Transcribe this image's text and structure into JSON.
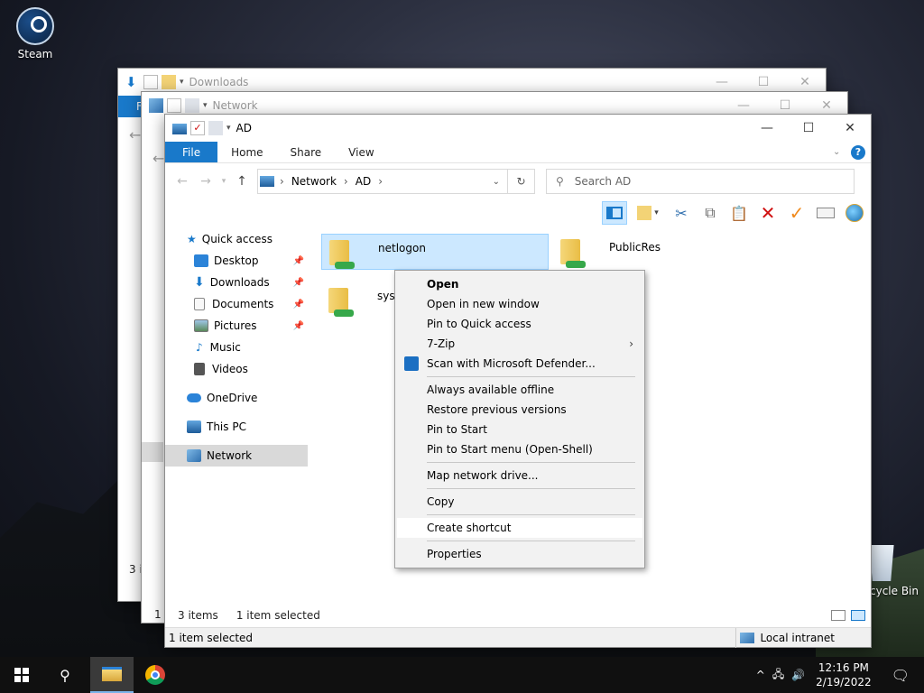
{
  "desktop": {
    "steam_label": "Steam",
    "recycle_label": "cycle Bin"
  },
  "windows": {
    "downloads": {
      "title": "Downloads",
      "ribbon_file_partial": "F",
      "status_items_partial": "3 it"
    },
    "network": {
      "title": "Network",
      "status_selected_partial": "1 it"
    },
    "ad": {
      "title": "AD",
      "tabs": [
        "File",
        "Home",
        "Share",
        "View"
      ],
      "breadcrumb": [
        "Network",
        "AD"
      ],
      "search_placeholder": "Search AD",
      "nav": {
        "quick_access": "Quick access",
        "desktop": "Desktop",
        "downloads": "Downloads",
        "documents": "Documents",
        "pictures": "Pictures",
        "music": "Music",
        "videos": "Videos",
        "onedrive": "OneDrive",
        "thispc": "This PC",
        "network": "Network"
      },
      "files": {
        "netlogon": "netlogon",
        "publicres": "PublicRes",
        "sysvol": "sysvc"
      },
      "status": {
        "count": "3 items",
        "selected": "1 item selected"
      },
      "details": {
        "selected": "1 item selected",
        "zone": "Local intranet"
      }
    }
  },
  "context_menu": {
    "open": "Open",
    "open_new_window": "Open in new window",
    "pin_quick_access": "Pin to Quick access",
    "sevenzip": "7-Zip",
    "defender": "Scan with Microsoft Defender...",
    "always_offline": "Always available offline",
    "restore_versions": "Restore previous versions",
    "pin_start": "Pin to Start",
    "pin_start_openshell": "Pin to Start menu (Open-Shell)",
    "map_drive": "Map network drive...",
    "copy": "Copy",
    "create_shortcut": "Create shortcut",
    "properties": "Properties"
  },
  "taskbar": {
    "time": "12:16 PM",
    "date": "2/19/2022"
  },
  "colors": {
    "accent": "#1979ca",
    "selection": "#cce8ff",
    "delete_red": "#d01010",
    "check_orange": "#f08a1c"
  }
}
